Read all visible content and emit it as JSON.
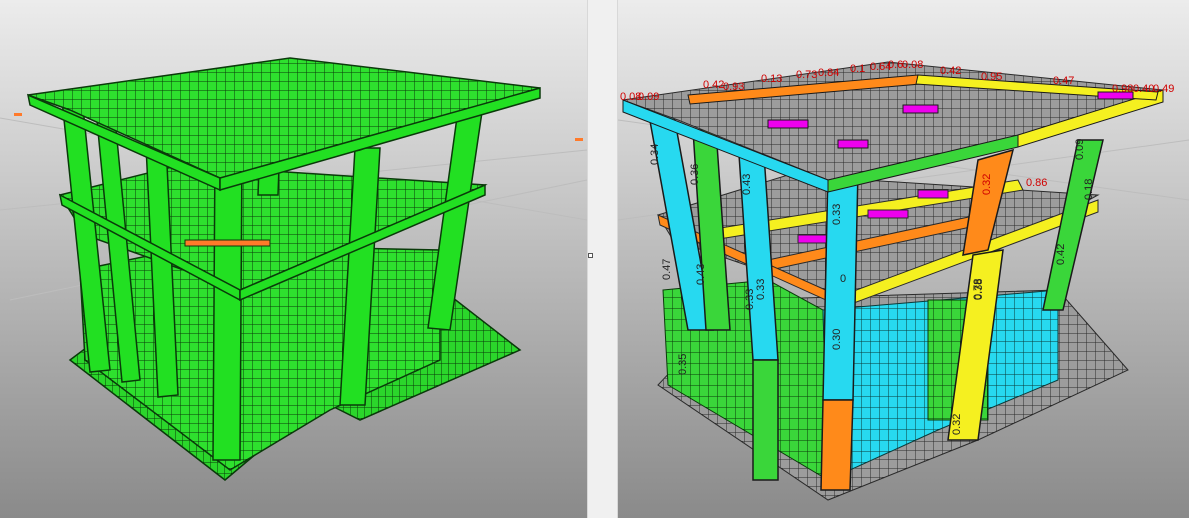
{
  "app": {
    "title": ""
  },
  "left_view": {
    "name": "3D structural model view",
    "colors": {
      "member": "#22e022",
      "mesh": "#2bd62b",
      "edge": "#0a3a0a",
      "bg_top": "#e8e8e8",
      "bg_bottom": "#8c8c8c"
    }
  },
  "right_view": {
    "name": "3D utilization ratio view",
    "colors": {
      "cyan": "#27d9f0",
      "green": "#3ad63a",
      "yellow": "#f5f020",
      "orange": "#ff8a1a",
      "magenta": "#ee00ee",
      "grey": "#9a9a9a",
      "label": "#d00000"
    },
    "labels_top": [
      "0.42",
      "0.93",
      "0.13",
      "0.73",
      "0.84",
      "0.1",
      "0.64",
      "0.6",
      "0.08",
      "0.42",
      "0.95",
      "0.47",
      "0.98",
      "0.40",
      "0.49",
      "0.08",
      "0.09"
    ],
    "labels_column": [
      "0.34",
      "0.36",
      "0.43",
      "0.33",
      "0.33",
      "0.47",
      "0.43",
      "0.33",
      "0.30",
      "0.38",
      "0.32",
      "0.78",
      "0.32",
      "0.09",
      "0.86",
      "0.18",
      "0.42",
      "0.35",
      "0"
    ]
  }
}
